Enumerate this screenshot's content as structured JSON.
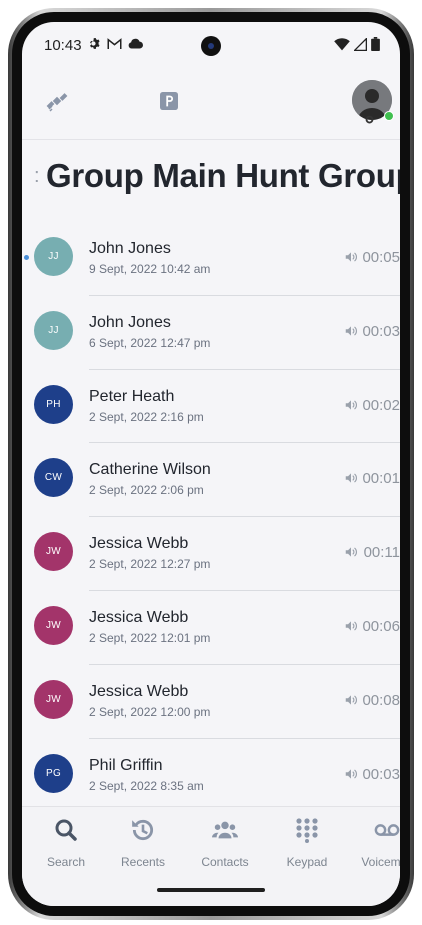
{
  "status_bar": {
    "time": "10:43",
    "icons_left": [
      "gear-icon",
      "gmail-icon",
      "cloud-icon"
    ],
    "icons_right": [
      "wifi-icon",
      "signal-icon",
      "battery-icon"
    ]
  },
  "toolbar": {
    "icons": [
      "satellite-icon",
      "moon-icon",
      "parking-icon"
    ],
    "presence_color": "#3fbf4f"
  },
  "page": {
    "ellipsis": ":",
    "title": "Group Main Hunt Group"
  },
  "calls": [
    {
      "initials": "JJ",
      "name": "John Jones",
      "date": "9 Sept, 2022 10:42 am",
      "duration": "00:05",
      "color": "#77aeb1",
      "unread": true
    },
    {
      "initials": "JJ",
      "name": "John Jones",
      "date": "6 Sept, 2022 12:47 pm",
      "duration": "00:03",
      "color": "#77aeb1",
      "unread": false
    },
    {
      "initials": "PH",
      "name": "Peter Heath",
      "date": "2 Sept, 2022 2:16 pm",
      "duration": "00:02",
      "color": "#1e3f8a",
      "unread": false
    },
    {
      "initials": "CW",
      "name": "Catherine Wilson",
      "date": "2 Sept, 2022 2:06 pm",
      "duration": "00:01",
      "color": "#1e3f8a",
      "unread": false
    },
    {
      "initials": "JW",
      "name": "Jessica Webb",
      "date": "2 Sept, 2022 12:27 pm",
      "duration": "00:11",
      "color": "#a3346a",
      "unread": false
    },
    {
      "initials": "JW",
      "name": "Jessica Webb",
      "date": "2 Sept, 2022 12:01 pm",
      "duration": "00:06",
      "color": "#a3346a",
      "unread": false
    },
    {
      "initials": "JW",
      "name": "Jessica Webb",
      "date": "2 Sept, 2022 12:00 pm",
      "duration": "00:08",
      "color": "#a3346a",
      "unread": false
    },
    {
      "initials": "PG",
      "name": "Phil Griffin",
      "date": "2 Sept, 2022 8:35 am",
      "duration": "00:03",
      "color": "#1e3f8a",
      "unread": false
    }
  ],
  "nav": [
    {
      "label": "Search",
      "icon": "search-icon",
      "active": true
    },
    {
      "label": "Recents",
      "icon": "history-icon",
      "active": false
    },
    {
      "label": "Contacts",
      "icon": "contacts-icon",
      "active": false
    },
    {
      "label": "Keypad",
      "icon": "keypad-icon",
      "active": false
    },
    {
      "label": "Voicemail",
      "icon": "voicemail-icon",
      "active": false
    }
  ],
  "colors": {
    "accent_active_nav": "#4a5566",
    "muted_icon": "#8a95a8"
  }
}
